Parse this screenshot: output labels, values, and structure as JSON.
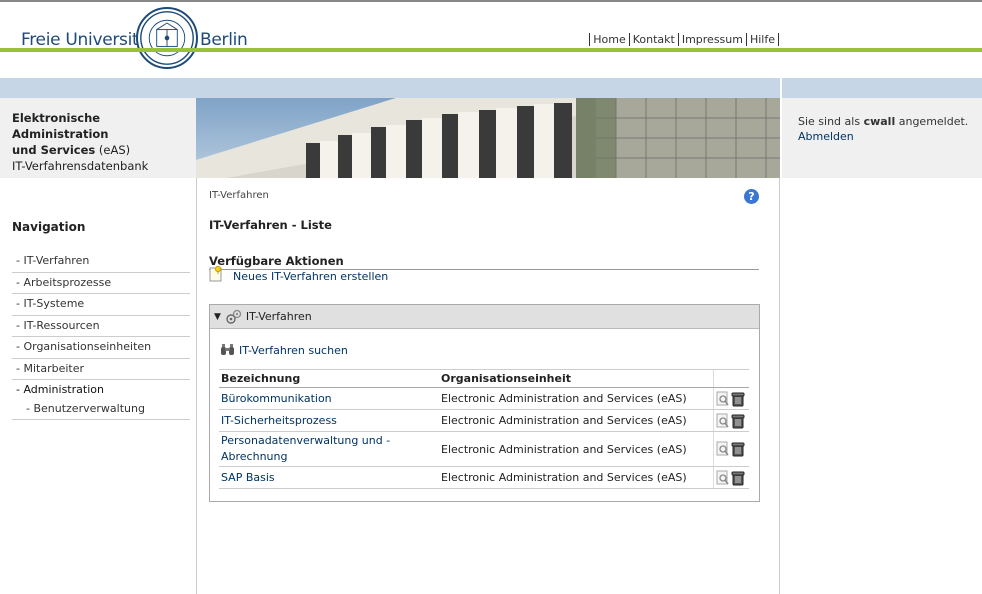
{
  "header": {
    "logo_left": "Freie Universität",
    "logo_right": "Berlin",
    "seal_text": "VERITAS IUSTITIA LIBERTAS · FREIE UNIVERSITÄT BERLIN",
    "nav": [
      "Home",
      "Kontakt",
      "Impressum",
      "Hilfe"
    ],
    "app_line1": "Elektronische",
    "app_line2": "Administration",
    "app_line3_bold": "und Services",
    "app_line3_rest": " (eAS)",
    "app_line4": "IT-Verfahrensdatenbank",
    "login_prefix": "Sie sind als ",
    "login_user": "cwall",
    "login_suffix": " angemeldet.",
    "logout": "Abmelden"
  },
  "sidebar": {
    "title": "Navigation",
    "items": [
      {
        "label": "- IT-Verfahren"
      },
      {
        "label": "- Arbeitsprozesse"
      },
      {
        "label": "- IT-Systeme"
      },
      {
        "label": "- IT-Ressourcen"
      },
      {
        "label": "- Organisationseinheiten"
      },
      {
        "label": "- Mitarbeiter"
      },
      {
        "label": "- Administration"
      }
    ],
    "sub_items": [
      {
        "label": "- Benutzerverwaltung"
      }
    ]
  },
  "main": {
    "breadcrumb": "IT-Verfahren",
    "help": "?",
    "title": "IT-Verfahren - Liste",
    "actions_heading": "Verfügbare Aktionen",
    "new_action": "Neues IT-Verfahren erstellen",
    "panel_title": "IT-Verfahren",
    "search_link": "IT-Verfahren suchen",
    "table": {
      "headers": [
        "Bezeichnung",
        "Organisationseinheit"
      ],
      "rows": [
        {
          "name": "Bürokommunikation",
          "org": "Electronic Administration and Services (eAS)"
        },
        {
          "name": "IT-Sicherheitsprozess",
          "org": "Electronic Administration and Services (eAS)"
        },
        {
          "name": "Personadatenverwaltung und -Abrechnung",
          "org": "Electronic Administration and Services (eAS)"
        },
        {
          "name": "SAP Basis",
          "org": "Electronic Administration and Services (eAS)"
        }
      ]
    }
  },
  "colors": {
    "accent_green": "#99c23a",
    "blue_bar": "#c6d6e7",
    "link": "#003366"
  }
}
